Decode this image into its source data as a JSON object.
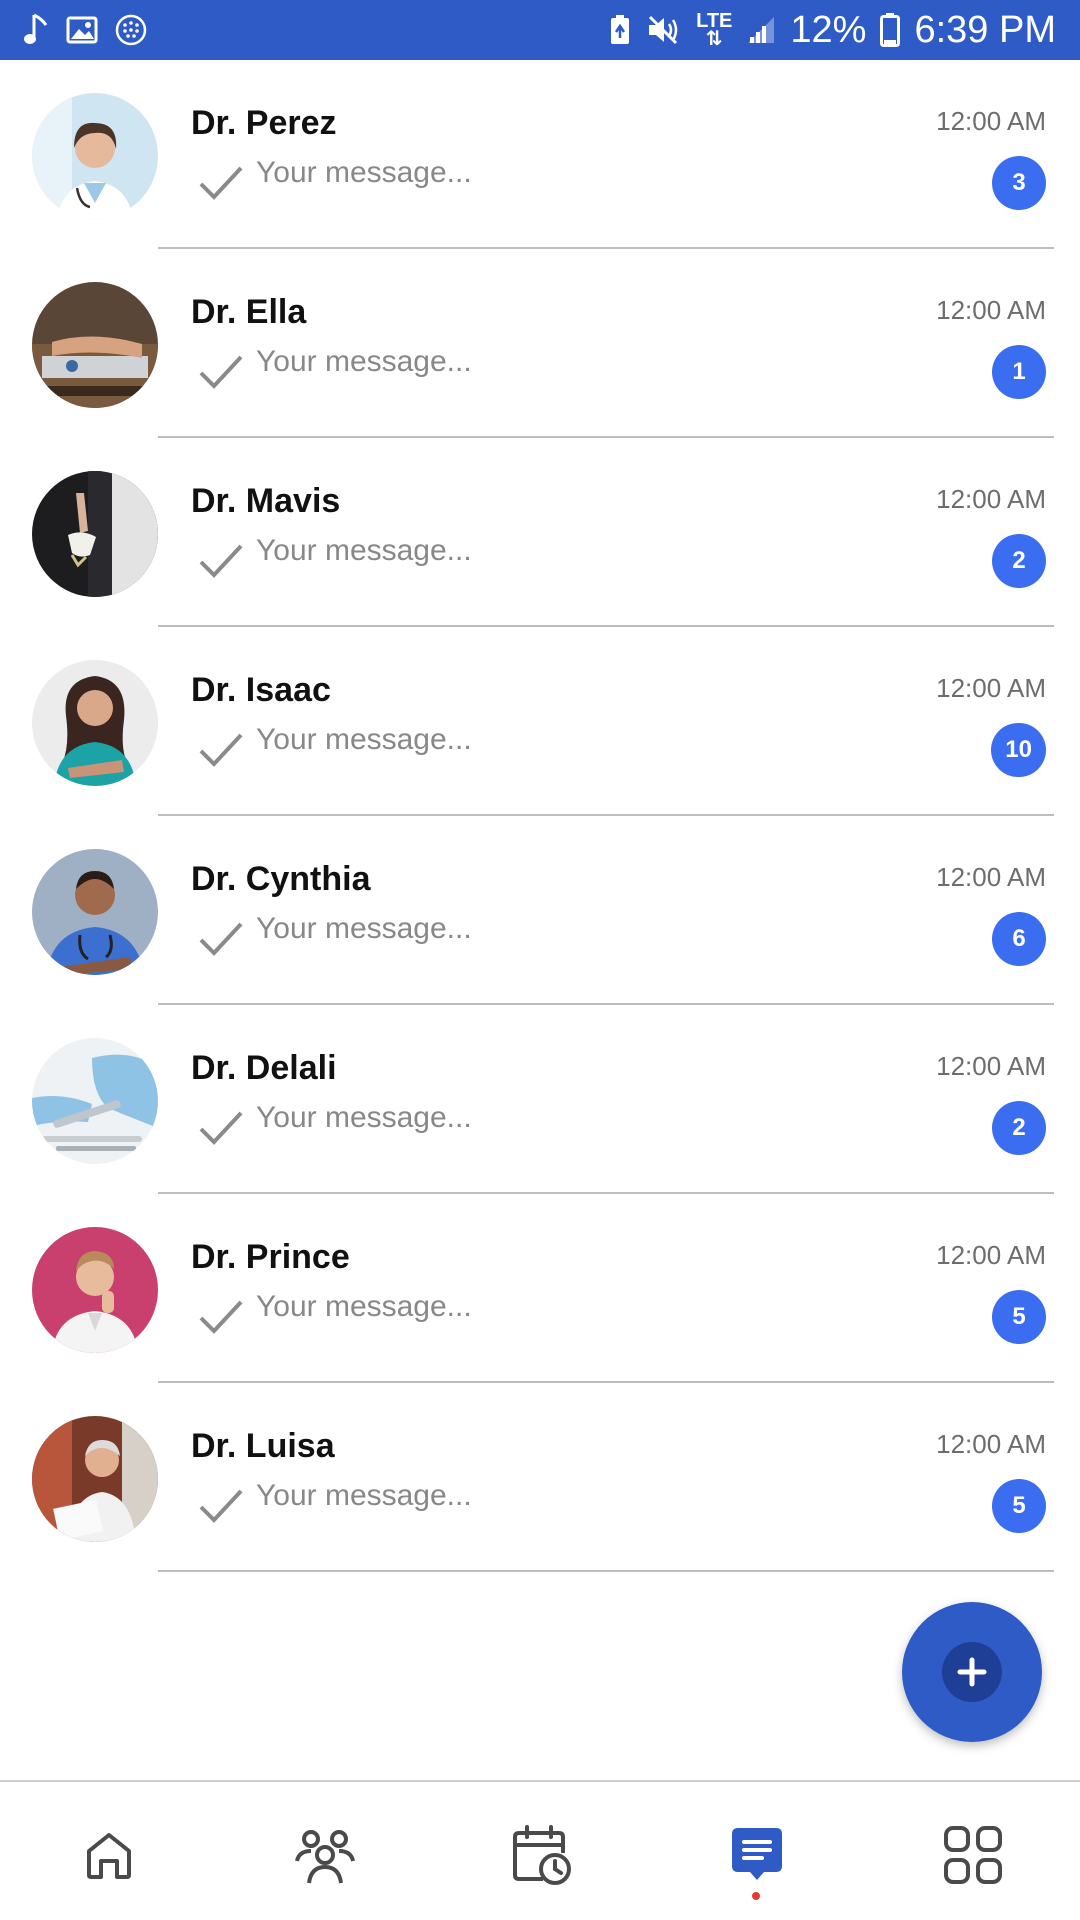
{
  "status_bar": {
    "battery_percent": "12%",
    "time": "6:39 PM",
    "network_label": "LTE",
    "icons": [
      "music-note-icon",
      "gallery-icon",
      "dotted-circle-icon",
      "battery-saver-icon",
      "mute-icon",
      "lte-icon",
      "signal-icon",
      "battery-icon"
    ]
  },
  "chats": [
    {
      "name": "Dr. Perez",
      "preview": "Your message...",
      "time": "12:00 AM",
      "unread": "3"
    },
    {
      "name": "Dr. Ella",
      "preview": "Your message...",
      "time": "12:00 AM",
      "unread": "1"
    },
    {
      "name": "Dr. Mavis",
      "preview": "Your message...",
      "time": "12:00 AM",
      "unread": "2"
    },
    {
      "name": "Dr. Isaac",
      "preview": "Your message...",
      "time": "12:00 AM",
      "unread": "10"
    },
    {
      "name": "Dr. Cynthia",
      "preview": "Your message...",
      "time": "12:00 AM",
      "unread": "6"
    },
    {
      "name": "Dr. Delali",
      "preview": "Your message...",
      "time": "12:00 AM",
      "unread": "2"
    },
    {
      "name": "Dr. Prince",
      "preview": "Your message...",
      "time": "12:00 AM",
      "unread": "5"
    },
    {
      "name": "Dr. Luisa",
      "preview": "Your message...",
      "time": "12:00 AM",
      "unread": "5"
    }
  ],
  "fab": {
    "icon": "plus-icon"
  },
  "bottom_nav": {
    "items": [
      "home-icon",
      "people-icon",
      "calendar-clock-icon",
      "chat-icon",
      "grid-icon"
    ],
    "active": "chat-icon"
  },
  "colors": {
    "primary": "#2f5bc7",
    "badge": "#3b6df0",
    "active_dot": "#e53935"
  }
}
